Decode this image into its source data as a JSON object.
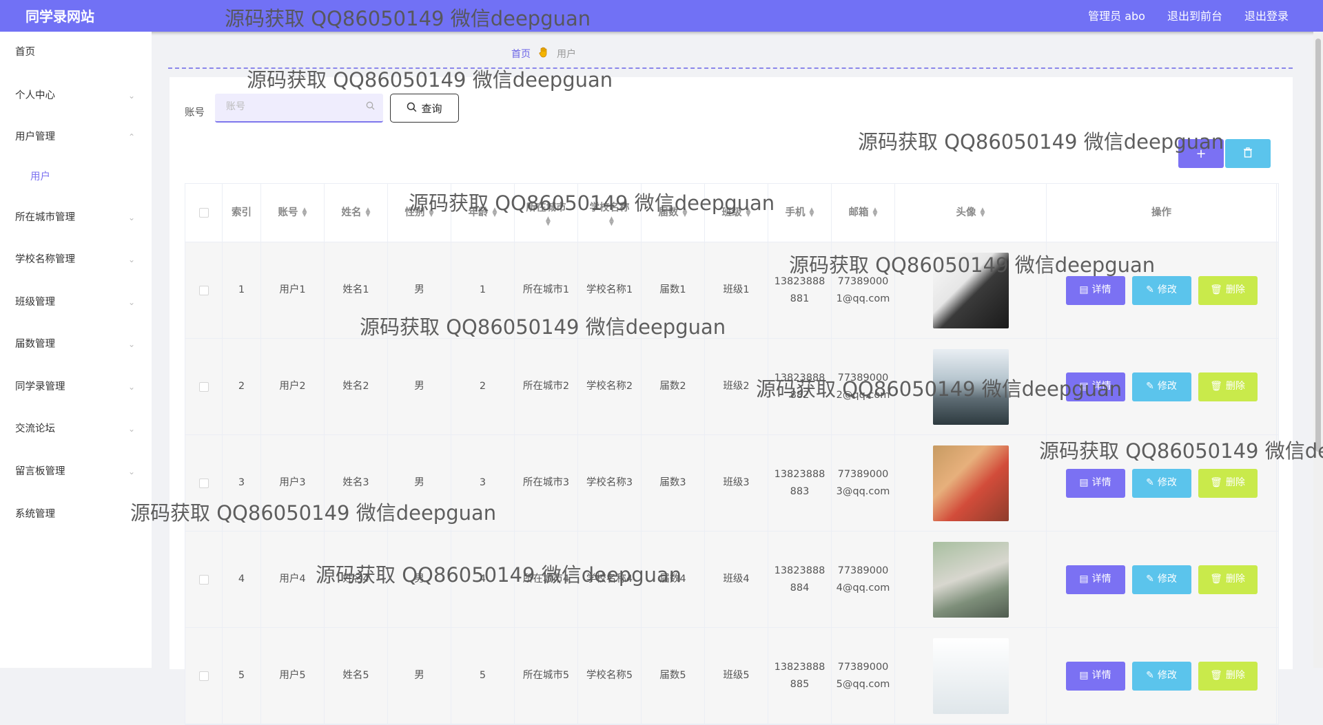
{
  "header": {
    "site_title": "同学录网站",
    "admin_label": "管理员 abo",
    "back_front": "退出到前台",
    "logout": "退出登录"
  },
  "sidebar": {
    "items": [
      {
        "label": "首页",
        "chevron": ""
      },
      {
        "label": "个人中心",
        "chevron": "⌄"
      },
      {
        "label": "用户管理",
        "chevron": "⌃"
      },
      {
        "label": "用户",
        "chevron": ""
      },
      {
        "label": "所在城市管理",
        "chevron": "⌄"
      },
      {
        "label": "学校名称管理",
        "chevron": "⌄"
      },
      {
        "label": "班级管理",
        "chevron": "⌄"
      },
      {
        "label": "届数管理",
        "chevron": "⌄"
      },
      {
        "label": "同学录管理",
        "chevron": "⌄"
      },
      {
        "label": "交流论坛",
        "chevron": "⌄"
      },
      {
        "label": "留言板管理",
        "chevron": "⌄"
      },
      {
        "label": "系统管理",
        "chevron": ""
      }
    ]
  },
  "breadcrumb": {
    "home": "首页",
    "sep_icon": "hand-icon",
    "current": "用户"
  },
  "search": {
    "label": "账号",
    "placeholder": "账号",
    "button": "查询"
  },
  "toolbar": {
    "add_symbol": "+",
    "delete_icon": "trash-icon"
  },
  "table": {
    "headers": [
      "索引",
      "账号",
      "姓名",
      "性别",
      "年龄",
      "所在城市",
      "学校名称",
      "届数",
      "班级",
      "手机",
      "邮箱",
      "头像",
      "操作"
    ],
    "rows": [
      {
        "index": "1",
        "account": "用户1",
        "name": "姓名1",
        "gender": "男",
        "age": "1",
        "city": "所在城市1",
        "school": "学校名称1",
        "session": "届数1",
        "class": "班级1",
        "phone": "13823888881",
        "email": "773890001@qq.com"
      },
      {
        "index": "2",
        "account": "用户2",
        "name": "姓名2",
        "gender": "男",
        "age": "2",
        "city": "所在城市2",
        "school": "学校名称2",
        "session": "届数2",
        "class": "班级2",
        "phone": "13823888882",
        "email": "773890002@qq.com"
      },
      {
        "index": "3",
        "account": "用户3",
        "name": "姓名3",
        "gender": "男",
        "age": "3",
        "city": "所在城市3",
        "school": "学校名称3",
        "session": "届数3",
        "class": "班级3",
        "phone": "13823888883",
        "email": "773890003@qq.com"
      },
      {
        "index": "4",
        "account": "用户4",
        "name": "姓名4",
        "gender": "男",
        "age": "4",
        "city": "所在城市4",
        "school": "学校名称4",
        "session": "届数4",
        "class": "班级4",
        "phone": "13823888884",
        "email": "773890004@qq.com"
      },
      {
        "index": "5",
        "account": "用户5",
        "name": "姓名5",
        "gender": "男",
        "age": "5",
        "city": "所在城市5",
        "school": "学校名称5",
        "session": "届数5",
        "class": "班级5",
        "phone": "13823888885",
        "email": "773890005@qq.com"
      }
    ],
    "actions": {
      "detail": "详情",
      "edit": "修改",
      "delete": "删除"
    }
  },
  "watermark": "源码获取 QQ86050149 微信deepguan",
  "colors": {
    "brand": "#7171f5",
    "detail": "#7b71f3",
    "edit": "#5bc4ec",
    "delete": "#c9ea4b"
  }
}
